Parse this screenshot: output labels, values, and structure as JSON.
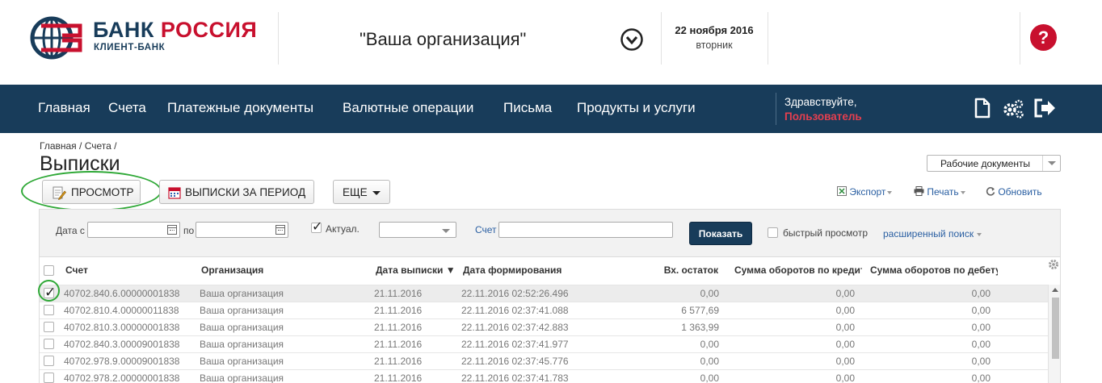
{
  "header": {
    "logo_title_part1": "БАНК",
    "logo_title_part2": "РОССИЯ",
    "logo_subtitle": "КЛИЕНТ-БАНК",
    "organization": "\"Ваша организация\"",
    "date": "22 ноября 2016",
    "weekday": "вторник",
    "help_label": "?"
  },
  "nav": {
    "items": [
      "Главная",
      "Счета",
      "Платежные документы",
      "Валютные операции",
      "Письма",
      "Продукты и услуги"
    ],
    "greeting": "Здравствуйте,",
    "user": "Пользователь"
  },
  "breadcrumb": [
    "Главная",
    "Счета"
  ],
  "page_title": "Выписки",
  "docs_select": "Рабочие документы",
  "toolbar": {
    "view": "ПРОСМОТР",
    "period": "ВЫПИСКИ ЗА ПЕРИОД",
    "more": "ЕЩЕ",
    "export": "Экспорт",
    "print": "Печать",
    "refresh": "Обновить"
  },
  "filter": {
    "date_from_label": "Дата с",
    "date_to_label": "по",
    "actual_label": "Актуал.",
    "account_label": "Счет",
    "show_button": "Показать",
    "quick_view_label": "быстрый просмотр",
    "advanced_search": "расширенный поиск"
  },
  "table": {
    "columns": [
      "Счет",
      "Организация",
      "Дата выписки ▼",
      "Дата формирования",
      "Вх. остаток",
      "Сумма оборотов по кредиту",
      "Сумма оборотов по дебету"
    ],
    "rows": [
      {
        "account": "40702.840.6.00000001838",
        "org": "Ваша организация",
        "date": "21.11.2016",
        "formed": "22.11.2016 02:52:26.496",
        "opening": "0,00",
        "credit": "0,00",
        "debit": "0,00",
        "checked": true
      },
      {
        "account": "40702.810.4.00000011838",
        "org": "Ваша организация",
        "date": "21.11.2016",
        "formed": "22.11.2016 02:37:41.088",
        "opening": "6 577,69",
        "credit": "0,00",
        "debit": "0,00",
        "checked": false
      },
      {
        "account": "40702.810.3.00000001838",
        "org": "Ваша организация",
        "date": "21.11.2016",
        "formed": "22.11.2016 02:37:42.883",
        "opening": "1 363,99",
        "credit": "0,00",
        "debit": "0,00",
        "checked": false
      },
      {
        "account": "40702.840.3.00009001838",
        "org": "Ваша организация",
        "date": "21.11.2016",
        "formed": "22.11.2016 02:37:41.977",
        "opening": "0,00",
        "credit": "0,00",
        "debit": "0,00",
        "checked": false
      },
      {
        "account": "40702.978.9.00009001838",
        "org": "Ваша организация",
        "date": "21.11.2016",
        "formed": "22.11.2016 02:37:45.776",
        "opening": "0,00",
        "credit": "0,00",
        "debit": "0,00",
        "checked": false
      },
      {
        "account": "40702.978.2.00000001838",
        "org": "Ваша организация",
        "date": "21.11.2016",
        "formed": "22.11.2016 02:37:41.783",
        "opening": "0,00",
        "credit": "0,00",
        "debit": "0,00",
        "checked": false
      }
    ]
  },
  "icons": {
    "logo": "globe-logo-icon",
    "org_toggle": "chevron-circle-down-icon",
    "help": "question-circle-icon",
    "document": "document-icon",
    "settings": "gears-icon",
    "logout": "logout-icon",
    "view": "edit-document-icon",
    "calendar": "calendar-icon",
    "export": "excel-icon",
    "print": "printer-icon",
    "refresh": "refresh-icon",
    "table_settings": "gear-icon"
  },
  "colors": {
    "brand_navy": "#183c5a",
    "brand_red": "#c8102e",
    "link_blue": "#2a5fa2",
    "highlight_green": "#2ea836"
  }
}
